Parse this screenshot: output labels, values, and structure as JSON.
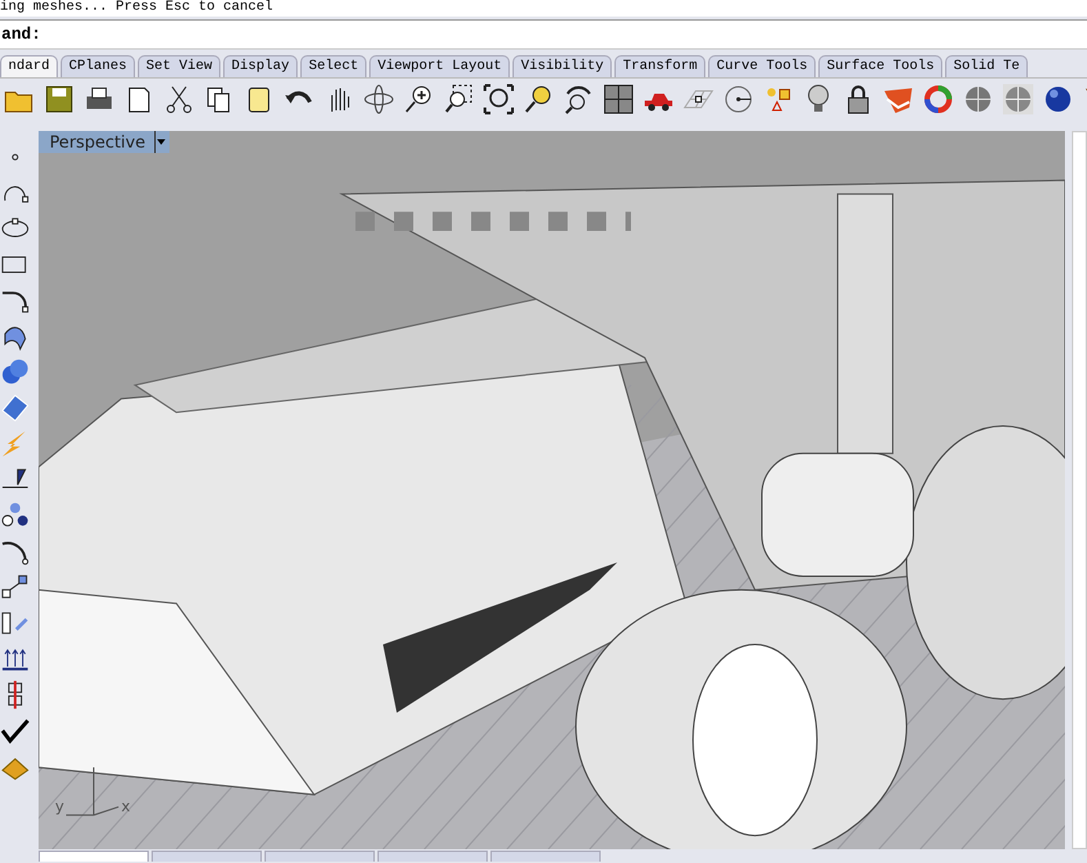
{
  "status_line": "ing meshes... Press Esc to cancel",
  "command": {
    "label": "and:"
  },
  "toolbar_tabs": [
    {
      "label": "ndard",
      "selected": true
    },
    {
      "label": "CPlanes",
      "selected": false
    },
    {
      "label": "Set View",
      "selected": false
    },
    {
      "label": "Display",
      "selected": false
    },
    {
      "label": "Select",
      "selected": false
    },
    {
      "label": "Viewport Layout",
      "selected": false
    },
    {
      "label": "Visibility",
      "selected": false
    },
    {
      "label": "Transform",
      "selected": false
    },
    {
      "label": "Curve Tools",
      "selected": false
    },
    {
      "label": "Surface Tools",
      "selected": false
    },
    {
      "label": "Solid Te",
      "selected": false
    }
  ],
  "viewport": {
    "title": "Perspective",
    "axis_x": "x",
    "axis_y": "y"
  },
  "bottom_tabs": [
    {
      "selected": true
    },
    {
      "selected": false
    },
    {
      "selected": false
    },
    {
      "selected": false
    },
    {
      "selected": false
    }
  ]
}
